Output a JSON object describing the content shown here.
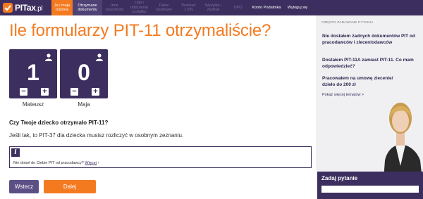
{
  "logo": {
    "brand": "PITax",
    "suffix": ".pl"
  },
  "nav": {
    "steps": [
      {
        "label": "Ja i moja rodzina",
        "state": "done"
      },
      {
        "label": "Otrzymane dokumenty",
        "state": "current"
      },
      {
        "label": "Inne przychody",
        "state": "next"
      },
      {
        "label": "Ulgi i odliczenia podatku",
        "state": "next"
      },
      {
        "label": "Dane osobowe",
        "state": "next"
      },
      {
        "label": "Przekaż 1,5%",
        "state": "next"
      },
      {
        "label": "Wysyłka i wydruk",
        "state": "next"
      },
      {
        "label": "UPO",
        "state": "next"
      }
    ],
    "account_label": "Konto Podatnika",
    "logout_label": "Wyloguj się"
  },
  "main": {
    "title": "Ile formularzy PIT-11 otrzymaliście?",
    "people": [
      {
        "name": "Mateusz",
        "count": "1"
      },
      {
        "name": "Maja",
        "count": "0"
      }
    ],
    "question": "Czy Twoje dziecko otrzymało PIT-11?",
    "note": "Jeśli tak, to PIT-37 dla dziecka musisz rozliczyć w osobnym zeznaniu.",
    "info": {
      "text": "Nie dotarł do Ciebie PIT od pracodawcy?",
      "link": "Więcej"
    },
    "back_label": "Wstecz",
    "next_label": "Dalej"
  },
  "sidebar": {
    "heading": "CZĘSTO ZADAWANE PYTANIA",
    "faq": [
      "Nie dostałem żadnych dokumentów PIT od pracodawców i zleceniodawców",
      "Dostałem PIT-11A zamiast PIT-11. Co mam odpowiedzieć?",
      "Pracowałem na umowę zlecenie/ dzieło do 200 zł"
    ],
    "more_label": "Pokaż więcej tematów >",
    "ask_label": "Zadaj pytanie",
    "ask_placeholder": ""
  },
  "colors": {
    "accent": "#f47a20",
    "brand": "#3c2f5f"
  }
}
